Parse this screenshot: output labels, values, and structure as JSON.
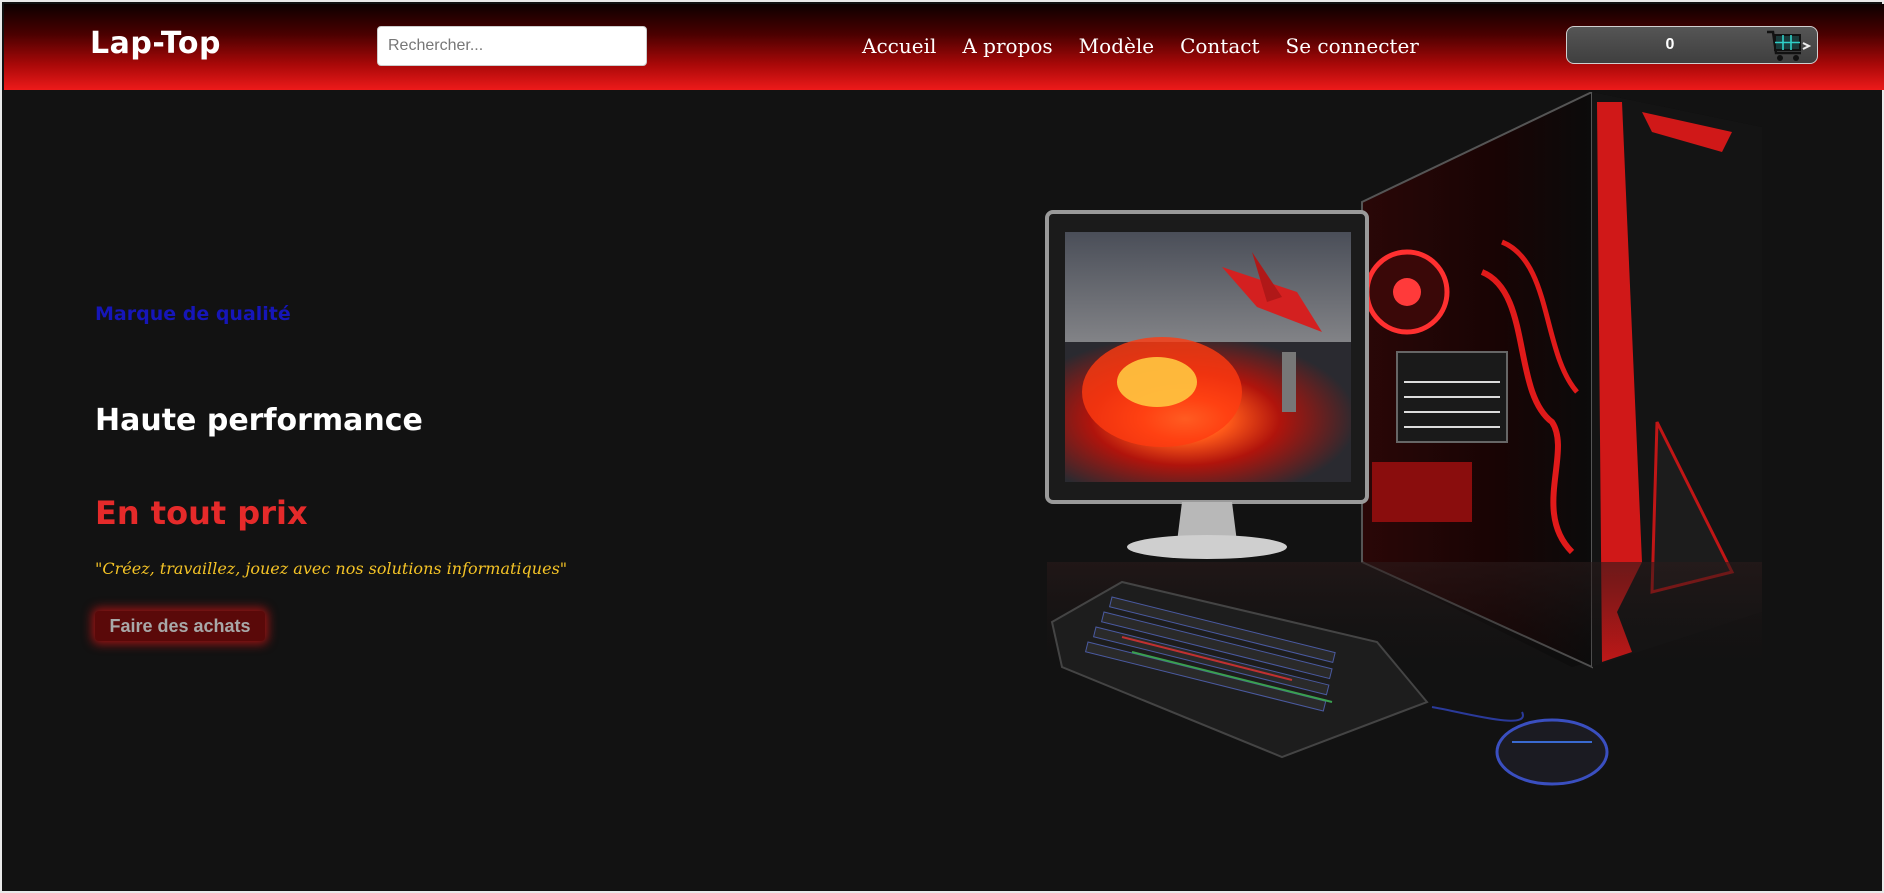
{
  "header": {
    "logo": "Lap-Top",
    "search_placeholder": "Rechercher...",
    "nav": [
      "Accueil",
      "A propos",
      "Modèle",
      "Contact",
      "Se connecter"
    ],
    "cart_count": "0",
    "cart_icon": "shopping-cart-icon"
  },
  "hero": {
    "tagline": "Marque de qualité",
    "headline": "Haute performance",
    "subheadline": "En tout prix",
    "quote": "\"Créez, travaillez, jouez avec nos solutions informatiques\"",
    "cta_label": "Faire des achats",
    "image": "gaming-pc-setup-image"
  },
  "colors": {
    "header_top": "#0c0000",
    "header_bottom": "#ee1a1a",
    "background": "#121212",
    "tagline": "#1616b8",
    "headline": "#ffffff",
    "subheadline": "#e52a2a",
    "quote": "#f4c326",
    "cta_bg": "#5a0909"
  }
}
